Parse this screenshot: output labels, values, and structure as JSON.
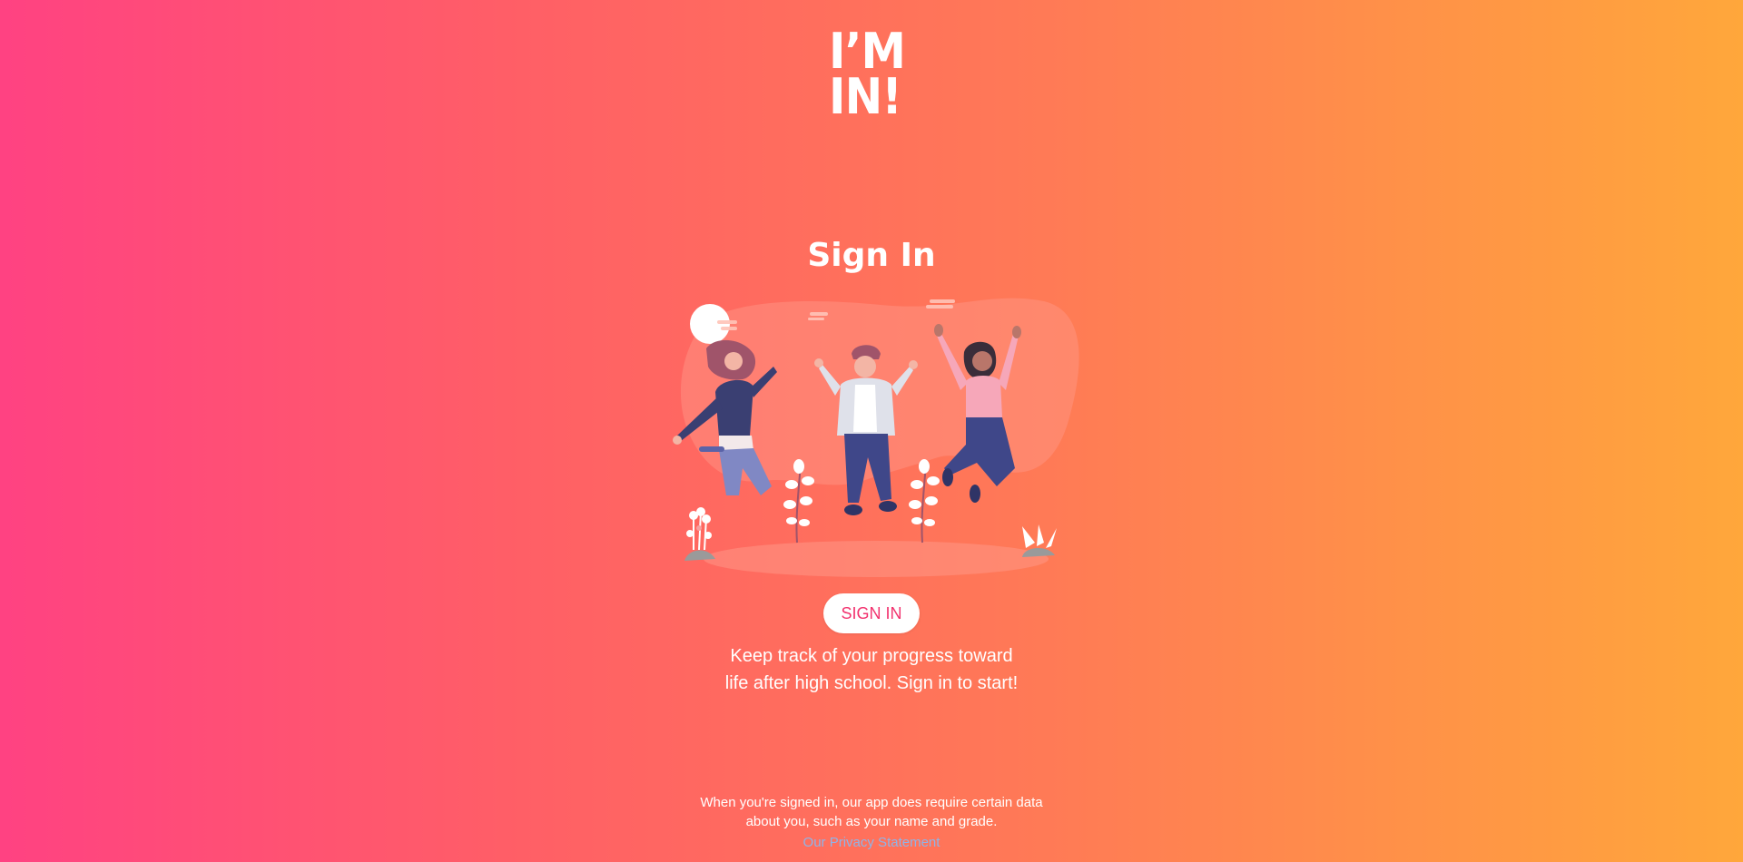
{
  "logo": {
    "line1": "I’M",
    "line2": "IN!"
  },
  "title": "Sign In",
  "sign_in_button": {
    "label": "SIGN IN"
  },
  "tagline": {
    "line1": "Keep track of your progress toward",
    "line2": "life after high school. Sign in to start!"
  },
  "footer": {
    "line1": "When you're signed in, our app does require certain data",
    "line2": "about you, such as your name and grade.",
    "privacy_link": "Our Privacy Statement"
  },
  "colors": {
    "gradient_start": "#ff4282",
    "gradient_end": "#ffa73b",
    "button_text": "#f2336f",
    "link": "#8fb4e8"
  }
}
